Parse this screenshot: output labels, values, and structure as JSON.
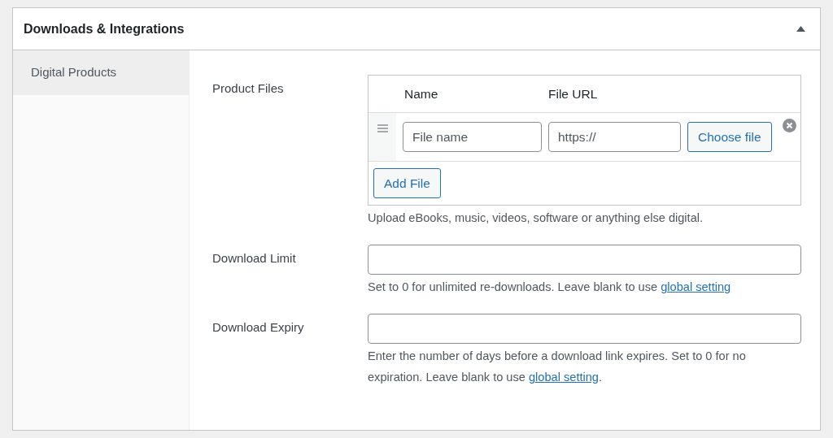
{
  "panel": {
    "title": "Downloads & Integrations"
  },
  "tabs": [
    {
      "label": "Digital Products",
      "selected": true
    }
  ],
  "fields": [
    {
      "kind": "files",
      "label": "Product Files",
      "columns": [
        "Name",
        "File URL"
      ],
      "rows": [
        {
          "name_placeholder": "File name",
          "url_placeholder": "https://",
          "choose_label": "Choose file"
        }
      ],
      "add_label": "Add File",
      "help": [
        {
          "kind": "text",
          "text": "Upload eBooks, music, videos, software or anything else digital."
        }
      ]
    },
    {
      "kind": "input",
      "label": "Download Limit",
      "help": [
        {
          "kind": "text",
          "text": "Set to 0 for unlimited re-downloads. Leave blank to use "
        },
        {
          "kind": "link",
          "text": "global setting"
        }
      ]
    },
    {
      "kind": "input",
      "label": "Download Expiry",
      "help": [
        {
          "kind": "text",
          "text": "Enter the number of days before a download link expires. Set to 0 for no expiration. Leave blank to use "
        },
        {
          "kind": "link",
          "text": "global setting"
        },
        {
          "kind": "text",
          "text": "."
        }
      ]
    }
  ]
}
